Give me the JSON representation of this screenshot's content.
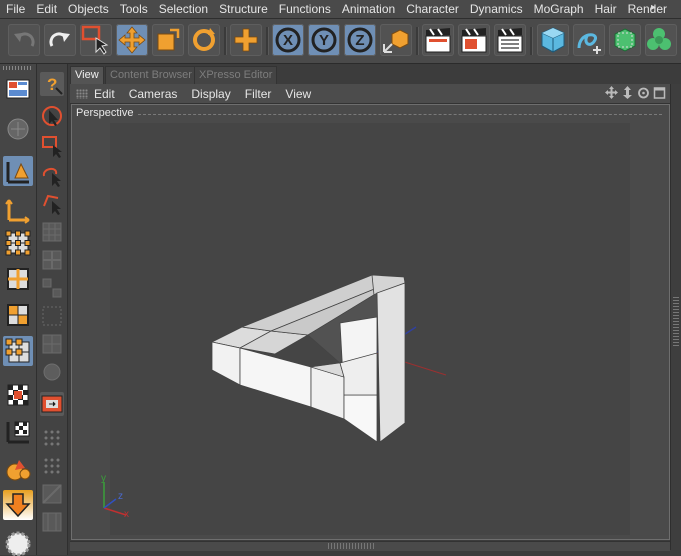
{
  "menubar": {
    "items": [
      "File",
      "Edit",
      "Objects",
      "Tools",
      "Selection",
      "Structure",
      "Functions",
      "Animation",
      "Character",
      "Dynamics",
      "MoGraph",
      "Hair",
      "Render"
    ],
    "more": "▸"
  },
  "toolbar": {
    "icons": [
      "undo-icon",
      "redo-icon",
      "live-selection-icon",
      "move-icon",
      "scale-icon",
      "rotate-icon",
      "add-icon",
      "x-axis-icon",
      "y-axis-icon",
      "z-axis-icon",
      "coordinate-system-icon",
      "render-view-icon",
      "render-picture-viewer-icon",
      "render-settings-icon",
      "cube-primitive-icon",
      "spline-icon",
      "nurbs-icon",
      "array-icon"
    ],
    "x_label": "X",
    "y_label": "Y",
    "z_label": "Z"
  },
  "tabs": [
    {
      "label": "View",
      "active": true
    },
    {
      "label": "Content Browser",
      "active": false
    },
    {
      "label": "XPresso Editor",
      "active": false
    }
  ],
  "view_menu": {
    "items": [
      "Edit",
      "Cameras",
      "Display",
      "Filter",
      "View"
    ]
  },
  "viewport": {
    "camera_label": "Perspective",
    "axis": {
      "x": "x",
      "y": "y",
      "z": "z"
    }
  },
  "colors": {
    "accent": "#6f8fb5",
    "orange": "#f0a030"
  }
}
